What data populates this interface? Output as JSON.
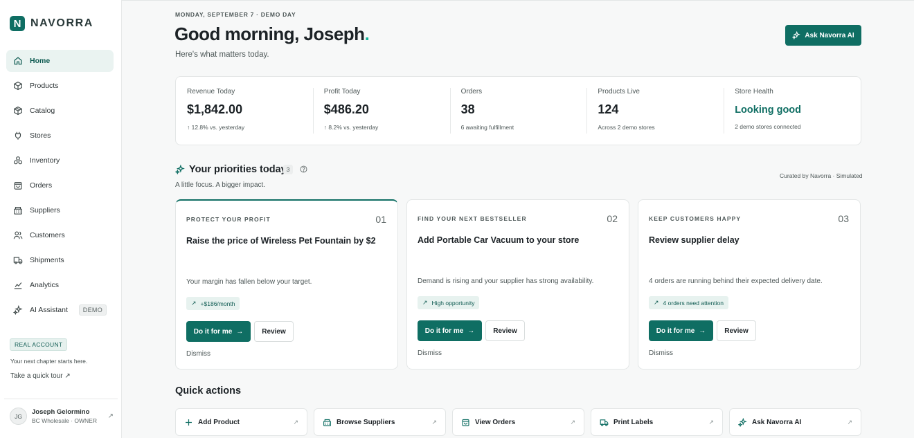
{
  "brand": {
    "logo_letter": "N",
    "name": "NAVORRA"
  },
  "sidebar": {
    "items": [
      {
        "label": "Home",
        "icon": "home-icon",
        "active": true
      },
      {
        "label": "Products",
        "icon": "box-icon"
      },
      {
        "label": "Catalog",
        "icon": "package-icon"
      },
      {
        "label": "Stores",
        "icon": "plug-icon"
      },
      {
        "label": "Inventory",
        "icon": "boxes-icon"
      },
      {
        "label": "Orders",
        "icon": "bag-icon"
      },
      {
        "label": "Suppliers",
        "icon": "building-icon"
      },
      {
        "label": "Customers",
        "icon": "users-icon"
      },
      {
        "label": "Shipments",
        "icon": "truck-icon"
      },
      {
        "label": "Analytics",
        "icon": "chart-icon"
      },
      {
        "label": "AI Assistant",
        "icon": "sparkle-icon",
        "badge": "DEMO"
      }
    ],
    "account_badge": "REAL ACCOUNT",
    "account_text": "Your next chapter starts here.",
    "tour_link": "Take a quick tour ↗",
    "user": {
      "initials": "JG",
      "name": "Joseph Gelormino",
      "role": "BC Wholesale · OWNER",
      "arrow": "↗"
    }
  },
  "header": {
    "date": "MONDAY, SEPTEMBER 7 · DEMO DAY",
    "greeting": "Good morning, Joseph",
    "greeting_dot": ".",
    "subtitle": "Here's what matters today.",
    "ask_button": "Ask Navorra AI"
  },
  "stats": [
    {
      "label": "Revenue Today",
      "value": "$1,842.00",
      "sub": "↑ 12.8% vs. yesterday"
    },
    {
      "label": "Profit Today",
      "value": "$486.20",
      "sub": "↑ 8.2% vs. yesterday"
    },
    {
      "label": "Orders",
      "value": "38",
      "sub": "6 awaiting fulfillment"
    },
    {
      "label": "Products Live",
      "value": "124",
      "sub": "Across 2 demo stores"
    },
    {
      "label": "Store Health",
      "value": "Looking good",
      "sub": "2 demo stores connected"
    }
  ],
  "priorities": {
    "title": "Your priorities today",
    "count": "3",
    "subtitle": "A little focus. A bigger impact.",
    "meta": "Curated by Navorra · Simulated",
    "cards": [
      {
        "kicker": "PROTECT YOUR PROFIT",
        "number": "01",
        "title": "Raise the price of Wireless Pet Fountain by $2",
        "desc": "Your margin has fallen below your target.",
        "tag": "+$186/month",
        "do": "Do it for me",
        "review": "Review",
        "dismiss": "Dismiss"
      },
      {
        "kicker": "FIND YOUR NEXT BESTSELLER",
        "number": "02",
        "title": "Add Portable Car Vacuum to your store",
        "desc": "Demand is rising and your supplier has strong availability.",
        "tag": "High opportunity",
        "do": "Do it for me",
        "review": "Review",
        "dismiss": "Dismiss"
      },
      {
        "kicker": "KEEP CUSTOMERS HAPPY",
        "number": "03",
        "title": "Review supplier delay",
        "desc": "4 orders are running behind their expected delivery date.",
        "tag": "4 orders need attention",
        "do": "Do it for me",
        "review": "Review",
        "dismiss": "Dismiss"
      }
    ]
  },
  "quick_actions": {
    "title": "Quick actions",
    "items": [
      {
        "label": "Add Product",
        "icon": "plus-icon"
      },
      {
        "label": "Browse Suppliers",
        "icon": "building-icon"
      },
      {
        "label": "View Orders",
        "icon": "bag-icon"
      },
      {
        "label": "Print Labels",
        "icon": "truck-icon"
      },
      {
        "label": "Ask Navorra AI",
        "icon": "sparkle-icon"
      }
    ]
  },
  "colors": {
    "accent": "#0f6e63",
    "accent_light": "#e7f2ef",
    "greeting_dot": "#14b59a"
  }
}
